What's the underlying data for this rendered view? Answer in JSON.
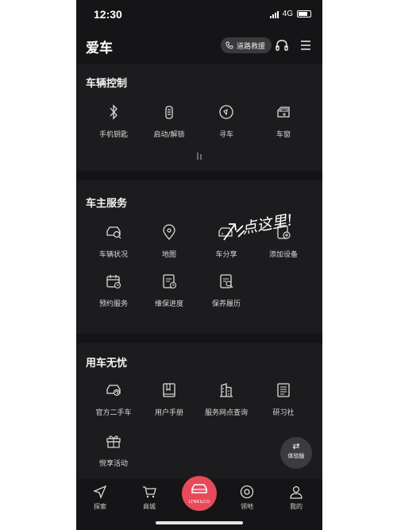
{
  "status_bar": {
    "time": "12:30",
    "network": "4G"
  },
  "header": {
    "title": "爱车",
    "rescue_label": "道路救援",
    "icons": [
      "phone-icon",
      "headset-icon",
      "menu-icon"
    ]
  },
  "sections": {
    "control": {
      "title": "车辆控制",
      "items": [
        {
          "label": "手机钥匙",
          "icon": "bluetooth-icon"
        },
        {
          "label": "启动/解锁",
          "icon": "key-fob-icon"
        },
        {
          "label": "寻车",
          "icon": "find-car-icon"
        },
        {
          "label": "车窗",
          "icon": "car-window-icon"
        }
      ]
    },
    "owner": {
      "title": "车主服务",
      "items": [
        {
          "label": "车辆状况",
          "icon": "car-status-icon"
        },
        {
          "label": "地图",
          "icon": "map-pin-icon"
        },
        {
          "label": "车分享",
          "icon": "car-share-icon"
        },
        {
          "label": "添加设备",
          "icon": "add-device-icon"
        },
        {
          "label": "预约服务",
          "icon": "calendar-icon"
        },
        {
          "label": "维保进度",
          "icon": "maintenance-progress-icon"
        },
        {
          "label": "保养履历",
          "icon": "maintenance-history-icon"
        }
      ]
    },
    "worry_free": {
      "title": "用车无忧",
      "items": [
        {
          "label": "官方二手车",
          "icon": "used-car-icon"
        },
        {
          "label": "用户手册",
          "icon": "manual-icon"
        },
        {
          "label": "服务网点查询",
          "icon": "service-outlet-icon"
        },
        {
          "label": "研习社",
          "icon": "study-icon"
        },
        {
          "label": "悦享活动",
          "icon": "gift-icon"
        }
      ]
    }
  },
  "annotation": {
    "text": "点这里!"
  },
  "experience_toggle": {
    "label": "体验版",
    "icon": "swap-icon"
  },
  "tab_bar": {
    "tabs": [
      {
        "label": "探索",
        "icon": "explore-icon"
      },
      {
        "label": "商城",
        "icon": "cart-icon"
      },
      {
        "label": "",
        "icon": "car-center-icon"
      },
      {
        "label": "领地",
        "icon": "territory-icon"
      },
      {
        "label": "我的",
        "icon": "profile-icon"
      }
    ],
    "center_logo": "LYNK&CO"
  }
}
